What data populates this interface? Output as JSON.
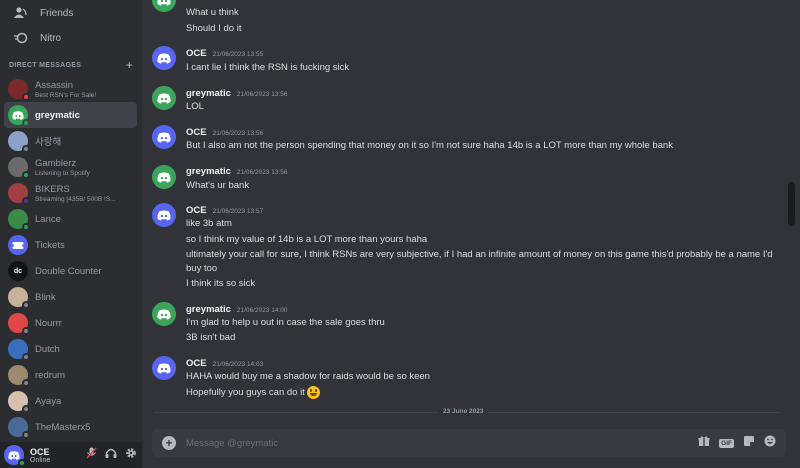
{
  "sidebar": {
    "nav": [
      {
        "label": "Friends",
        "icon": "friends-icon"
      },
      {
        "label": "Nitro",
        "icon": "nitro-icon"
      }
    ],
    "dm_header": "DIRECT MESSAGES",
    "dms": [
      {
        "name": "Assassin",
        "sub": "Best RSN's For Sale!",
        "status": "dnd"
      },
      {
        "name": "greymatic",
        "sub": "",
        "status": "online",
        "active": true
      },
      {
        "name": "사랑해",
        "sub": "",
        "status": "offline"
      },
      {
        "name": "Gamblerz",
        "sub": "Listening to Spotify",
        "status": "online"
      },
      {
        "name": "BIKERS",
        "sub": "Streaming [435B/ 500B !S...",
        "status": "streaming"
      },
      {
        "name": "Lance",
        "sub": "",
        "status": "online"
      },
      {
        "name": "Tickets",
        "sub": "",
        "status": "none"
      },
      {
        "name": "Double Counter",
        "sub": "",
        "status": "none"
      },
      {
        "name": "Blink",
        "sub": "",
        "status": "offline"
      },
      {
        "name": "Nourrr",
        "sub": "",
        "status": "offline"
      },
      {
        "name": "Dutch",
        "sub": "",
        "status": "offline"
      },
      {
        "name": "redrum",
        "sub": "",
        "status": "offline"
      },
      {
        "name": "Ayaya",
        "sub": "",
        "status": "offline"
      },
      {
        "name": "TheMasterx5",
        "sub": "",
        "status": "offline"
      }
    ]
  },
  "user_panel": {
    "name": "OCE",
    "status": "Online"
  },
  "messages": [
    {
      "author": "",
      "time": "",
      "lines": [
        "What u think",
        "Should I do it"
      ],
      "continuation": true
    },
    {
      "author": "OCE",
      "time": "21/06/2023 13:55",
      "lines": [
        "I cant lie I think the RSN is fucking sick"
      ]
    },
    {
      "author": "greymatic",
      "time": "21/06/2023 13:56",
      "lines": [
        "LOL"
      ]
    },
    {
      "author": "OCE",
      "time": "21/06/2023 13:56",
      "lines": [
        "But I also am not the person spending that money on it so I'm not sure haha 14b is a LOT more than my whole bank"
      ]
    },
    {
      "author": "greymatic",
      "time": "21/06/2023 13:56",
      "lines": [
        "What's ur bank"
      ]
    },
    {
      "author": "OCE",
      "time": "21/06/2023 13:57",
      "lines": [
        "like 3b atm",
        "so I think my value of 14b is a LOT more than yours haha",
        "ultimately your call for sure, I think RSNs are very subjective, if I had an infinite amount of money on this game this'd probably be a name I'd",
        "buy too",
        "I think its so sick"
      ]
    },
    {
      "author": "greymatic",
      "time": "21/06/2023 14:00",
      "lines": [
        "I'm glad to help u out in case the sale goes thru",
        "3B isn't bad"
      ]
    },
    {
      "author": "OCE",
      "time": "21/06/2023 14:03",
      "lines": [
        "HAHA would buy me a shadow for raids would be so keen",
        "Hopefully you guys can do it"
      ]
    }
  ],
  "date_divider": "23 June 2023",
  "composer": {
    "placeholder": "Message @greymatic"
  },
  "colors": {
    "accent": "#5865f2",
    "online": "#23a55a",
    "dnd": "#f23f43",
    "bot_green": "#3ba55c"
  }
}
